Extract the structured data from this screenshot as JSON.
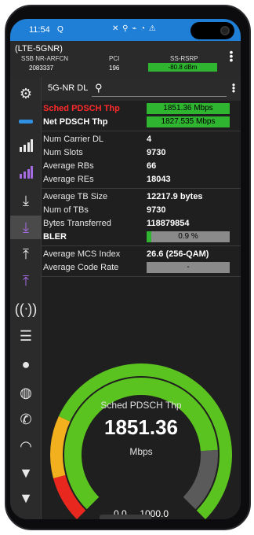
{
  "status_bar": {
    "time": "11:54",
    "app_indicator": "Q",
    "system_icons": "✕ ⚲ ⌁ ◔ ⚠"
  },
  "info_bar": {
    "title": "(LTE-5GNR)",
    "columns": [
      {
        "label": "SSB NR-ARFCN",
        "value": "2083337"
      },
      {
        "label": "PCI",
        "value": "196"
      },
      {
        "label": "SS-RSRP",
        "value": "-80.8 dBm"
      }
    ],
    "colors": {
      "good": "#2fb52f"
    }
  },
  "sidebar": {
    "items": [
      {
        "icon": "gear-icon"
      },
      {
        "icon": "antenna-bar-icon"
      },
      {
        "icon": "signal-bars-icon"
      },
      {
        "icon": "signal-bars-purple-icon"
      },
      {
        "icon": "download-icon"
      },
      {
        "icon": "download-purple-icon"
      },
      {
        "icon": "upload-icon"
      },
      {
        "icon": "upload-purple-icon"
      },
      {
        "icon": "broadcast-icon"
      },
      {
        "icon": "list-icon"
      },
      {
        "icon": "alert-icon"
      },
      {
        "icon": "globe-icon"
      },
      {
        "icon": "phone-icon"
      },
      {
        "icon": "wifi-icon"
      },
      {
        "icon": "wifi-alert-icon"
      },
      {
        "icon": "wifi-alert-2-icon"
      }
    ]
  },
  "tabs": {
    "active": "5G-NR DL"
  },
  "metrics": {
    "sched_pdsch_thp": {
      "label": "Sched PDSCH Thp",
      "value": "1851.36 Mbps"
    },
    "net_pdsch_thp": {
      "label": "Net PDSCH Thp",
      "value": "1827.535 Mbps"
    },
    "num_carrier_dl": {
      "label": "Num Carrier DL",
      "value": "4"
    },
    "num_slots": {
      "label": "Num Slots",
      "value": "9730"
    },
    "average_rbs": {
      "label": "Average RBs",
      "value": "66"
    },
    "average_res": {
      "label": "Average REs",
      "value": "18043"
    },
    "average_tb_size": {
      "label": "Average TB Size",
      "value": "12217.9 bytes"
    },
    "num_of_tbs": {
      "label": "Num of TBs",
      "value": "9730"
    },
    "bytes_transferred": {
      "label": "Bytes Transferred",
      "value": "118879854"
    },
    "bler": {
      "label": "BLER",
      "value": "0.9 %",
      "fill_percent": 0.9
    },
    "average_mcs_index": {
      "label": "Average MCS Index",
      "value": "26.6 (256-QAM)"
    },
    "average_code_rate": {
      "label": "Average Code Rate",
      "value": "-"
    }
  },
  "gauge": {
    "title": "Sched PDSCH Thp",
    "value": "1851.36",
    "unit": "Mbps",
    "range_text": "0.0 ... 1000.0",
    "needle_fraction": 0.82,
    "colors": {
      "green": "#5bc31f",
      "yellow": "#f2b01e",
      "red": "#e8281e",
      "gray": "#5a5a5a"
    }
  }
}
